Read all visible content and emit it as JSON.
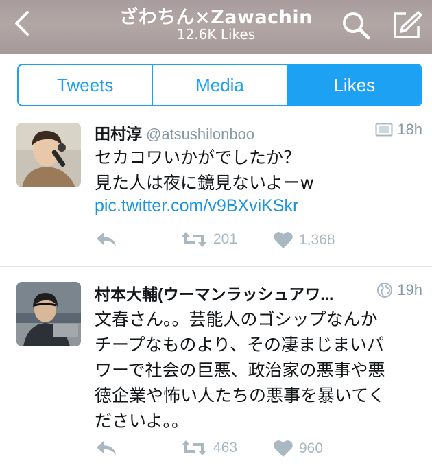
{
  "header": {
    "title": "ざわちん×Zawachin",
    "subtitle": "12.6K Likes"
  },
  "tabs": [
    {
      "label": "Tweets",
      "active": false
    },
    {
      "label": "Media",
      "active": false
    },
    {
      "label": "Likes",
      "active": true
    }
  ],
  "tweets": [
    {
      "name": "田村淳",
      "handle": "@atsushilonboo",
      "time": "18h",
      "meta_icon": "media-icon",
      "text": "セカコワいかがでしたか？\n見た人は夜に鏡見ないよーw",
      "link": "pic.twitter.com/v9BXviKSkr",
      "retweets": "201",
      "likes": "1,368"
    },
    {
      "name": "村本大輔(ウーマンラッシュアワ...",
      "handle": "",
      "time": "19h",
      "meta_icon": "globe-icon",
      "text": "文春さん。。芸能人のゴシップなんか\nチープなものより、その凄まじまいパ\nワーで社会の巨悪、政治家の悪事や悪\n徳企業や怖い人たちの悪事を暴いてく\nださいよ。。",
      "link": "",
      "retweets": "463",
      "likes": "960"
    }
  ],
  "colors": {
    "accent": "#1da1f2",
    "link": "#1b95e0",
    "muted": "#8899a6",
    "action": "#aab8c2",
    "header_bg": "#aca0a0"
  }
}
